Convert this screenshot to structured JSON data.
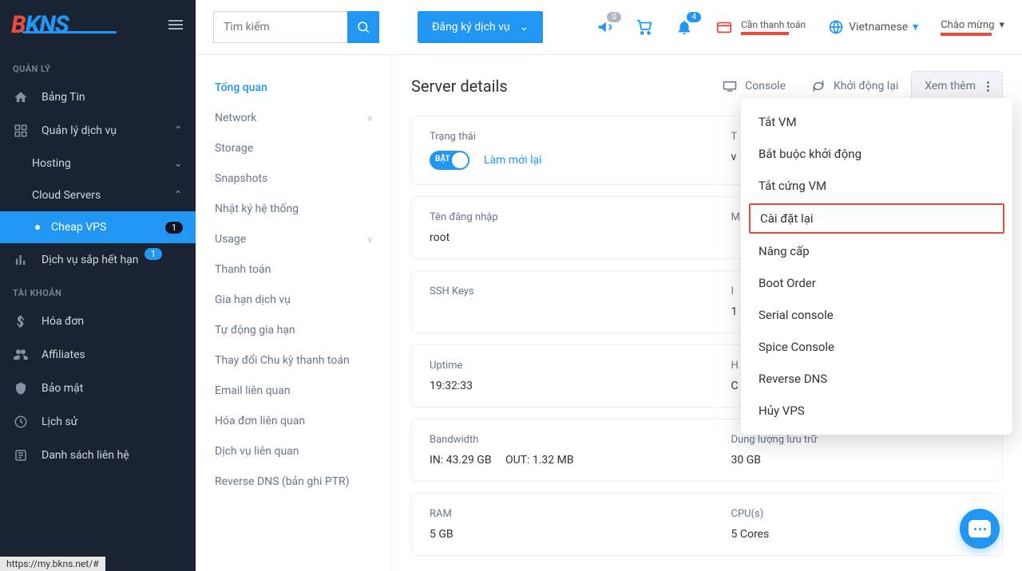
{
  "logo": {
    "b": "B",
    "kns": "KNS"
  },
  "search": {
    "placeholder": "Tìm kiếm"
  },
  "topbar": {
    "register": "Đăng ký dịch vụ",
    "notify_count": "0",
    "bell_count": "4",
    "pay_due": "Cần thanh toán",
    "language": "Vietnamese",
    "welcome": "Chào mừng"
  },
  "sidebar": {
    "section_manage": "QUẢN LÝ",
    "news": "Bảng Tin",
    "services": "Quản lý dịch vụ",
    "hosting": "Hosting",
    "cloud": "Cloud Servers",
    "cheap_vps": "Cheap VPS",
    "cheap_vps_badge": "1",
    "expiring": "Dịch vụ sắp hết hạn",
    "expiring_badge": "1",
    "section_account": "TÀI KHOẢN",
    "invoice": "Hóa đơn",
    "affiliates": "Affiliates",
    "security": "Bảo mật",
    "history": "Lịch sử",
    "contacts": "Danh sách liên hệ"
  },
  "subnav": {
    "overview": "Tổng quan",
    "network": "Network",
    "storage": "Storage",
    "snapshots": "Snapshots",
    "syslog": "Nhật ký hệ thống",
    "usage": "Usage",
    "billing": "Thanh toán",
    "renew": "Gia hạn dịch vụ",
    "autorenew": "Tự động gia hạn",
    "cycle": "Thay đổi Chu kỳ thanh toán",
    "emails": "Email liên quan",
    "invoices": "Hóa đơn liên quan",
    "related": "Dịch vụ liên quan",
    "rdns": "Reverse DNS (bản ghi PTR)"
  },
  "panel": {
    "title": "Server details",
    "console": "Console",
    "reboot": "Khởi động lại",
    "more": "Xem thêm",
    "status_label": "Trạng thái",
    "toggle_on": "BẬT",
    "refresh": "Làm mới lại",
    "login_label": "Tên đăng nhập",
    "login_value": "root",
    "ssh_label": "SSH Keys",
    "uptime_label": "Uptime",
    "uptime_value": "19:32:33",
    "bw_label": "Bandwidth",
    "bw_in": "IN: 43.29 GB",
    "bw_out": "OUT: 1.32 MB",
    "ram_label": "RAM",
    "ram_value": "5 GB",
    "storage_label": "Dung lượng lưu trữ",
    "storage_value": "30 GB",
    "cpu_label": "CPU(s)",
    "cpu_value": "5 Cores",
    "right_t": "T",
    "right_v": "v",
    "right_m": "M",
    "right_i": "I",
    "right_1": "1",
    "right_h": "H",
    "right_c": "C"
  },
  "dropdown": {
    "shutdown": "Tắt VM",
    "force_reboot": "Bắt buộc khởi động",
    "hard_off": "Tắt cứng VM",
    "reinstall": "Cài đặt lại",
    "upgrade": "Nâng cấp",
    "boot_order": "Boot Order",
    "serial": "Serial console",
    "spice": "Spice Console",
    "rdns": "Reverse DNS",
    "destroy": "Hủy VPS"
  },
  "statusbar": "https://my.bkns.net/#"
}
